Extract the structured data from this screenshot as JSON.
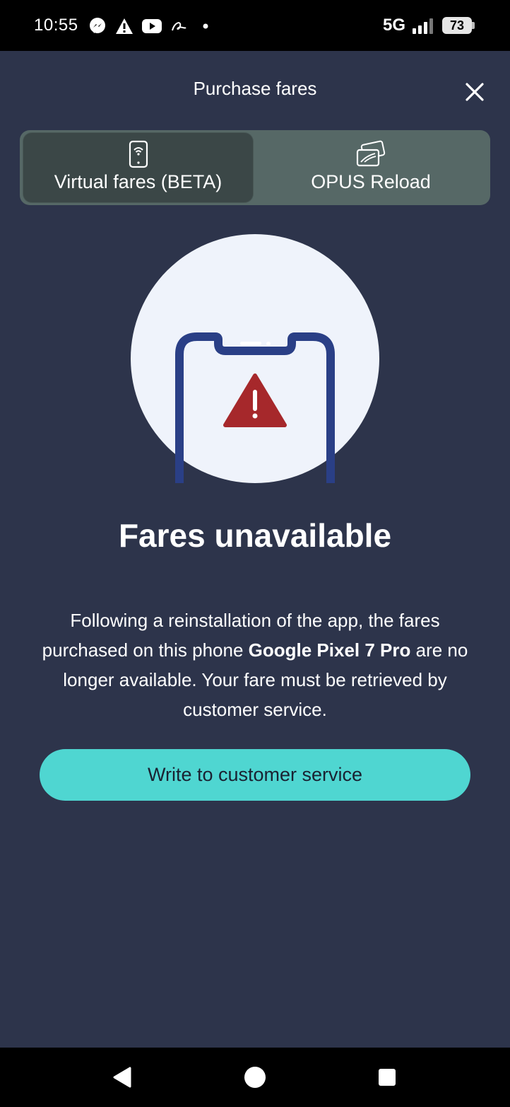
{
  "status_bar": {
    "time": "10:55",
    "network": "5G",
    "battery": "73",
    "icons": [
      "messenger-icon",
      "warning-icon",
      "youtube-icon",
      "app-icon",
      "dot-icon"
    ]
  },
  "header": {
    "title": "Purchase fares",
    "close_icon": "close-icon"
  },
  "tabs": [
    {
      "label": "Virtual fares (BETA)",
      "icon": "phone-wifi-icon",
      "selected": true
    },
    {
      "label": "OPUS Reload",
      "icon": "card-icon",
      "selected": false
    }
  ],
  "illustration": {
    "icon": "phone-warning-icon",
    "colors": {
      "circle": "#eff3fb",
      "phone": "#2a3f86",
      "warning": "#a6282b"
    }
  },
  "main": {
    "heading": "Fares unavailable",
    "message_part1": "Following a reinstallation of the app, the fares purchased on this phone ",
    "message_device": "Google Pixel 7 Pro",
    "message_part2": " are no longer available. Your fare must be retrieved by customer service.",
    "button_label": "Write to customer service"
  },
  "colors": {
    "background": "#2d344b",
    "tab_container": "#566866",
    "tab_active": "#3b4747",
    "button": "#4fd6d1"
  },
  "nav_bar": {
    "buttons": [
      "back-icon",
      "home-icon",
      "recents-icon"
    ]
  }
}
